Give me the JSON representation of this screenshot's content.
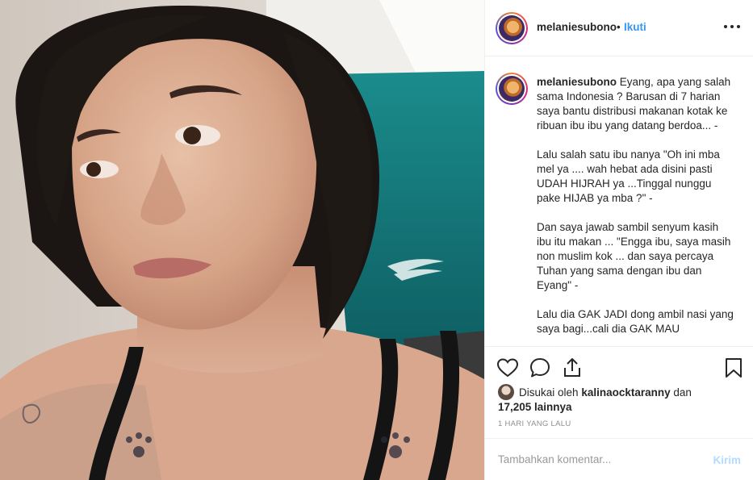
{
  "post": {
    "username": "melaniesubono",
    "separator": "•",
    "follow_label": "Ikuti",
    "more_icon": "ellipsis-icon"
  },
  "caption": {
    "username": "melaniesubono",
    "paragraphs": [
      "Eyang, apa yang salah sama Indonesia ? Barusan di 7 harian saya bantu distribusi makanan kotak ke ribuan ibu ibu yang datang berdoa... -",
      "Lalu salah satu ibu nanya \"Oh ini mba mel ya .... wah hebat ada disini pasti UDAH HIJRAH ya ...Tinggal nunggu pake HIJAB ya mba ?\" -",
      "Dan saya jawab sambil senyum kasih ibu itu makan ... \"Engga ibu, saya masih non muslim kok ... dan saya percaya Tuhan yang sama dengan ibu dan Eyang\" -",
      "Lalu dia GAK JADI dong ambil nasi yang saya bagi...cali dia GAK MAU"
    ]
  },
  "actions": {
    "like_icon": "heart-icon",
    "comment_icon": "comment-icon",
    "share_icon": "share-icon",
    "save_icon": "bookmark-icon"
  },
  "likes": {
    "prefix": "Disukai oleh",
    "liker": "kalinaocktaranny",
    "conj": "dan",
    "others": "17,205 lainnya"
  },
  "timestamp": "1 HARI YANG LALU",
  "comment_box": {
    "placeholder": "Tambahkan komentar...",
    "post_label": "Kirim"
  },
  "colors": {
    "link_blue": "#3897f0",
    "post_disabled": "#b3dbff",
    "text": "#262626",
    "muted": "#8e8e8e"
  }
}
